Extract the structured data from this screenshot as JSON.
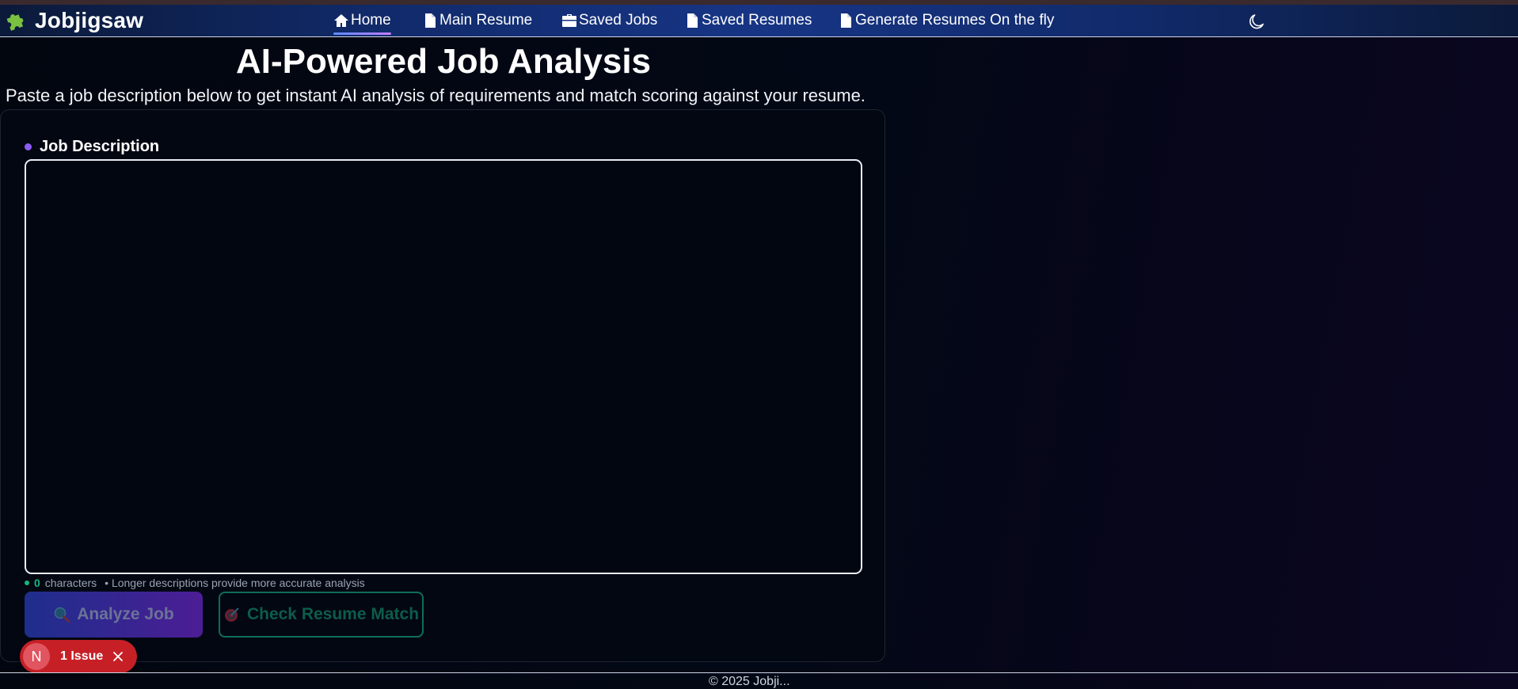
{
  "app": {
    "brand": "Jobjigsaw"
  },
  "nav": {
    "items": [
      {
        "label": "Home",
        "icon": "home-icon",
        "active": true
      },
      {
        "label": "Main Resume",
        "icon": "document-icon"
      },
      {
        "label": "Saved Jobs",
        "icon": "briefcase-icon"
      },
      {
        "label": "Saved Resumes",
        "icon": "document-icon"
      },
      {
        "label": "Generate Resumes On the fly",
        "icon": "document-icon"
      }
    ],
    "theme_toggle_icon": "moon-icon"
  },
  "main": {
    "title": "AI-Powered Job Analysis",
    "subtitle": "Paste a job description below to get instant AI analysis of requirements and match scoring against your resume.",
    "form": {
      "label": "Job Description",
      "textarea_value": "",
      "char_count": "0",
      "char_suffix": "characters",
      "hint": "• Longer descriptions provide more accurate analysis"
    },
    "buttons": {
      "analyze": {
        "label": "Analyze Job",
        "icon": "magnifier-icon",
        "disabled": true
      },
      "match": {
        "label": "Check Resume Match",
        "icon": "target-icon",
        "disabled": true
      }
    }
  },
  "issue_badge": {
    "letter": "N",
    "text": "1 Issue"
  },
  "footer": {
    "text": "© 2025 Jobji..."
  },
  "colors": {
    "background": "#02060f",
    "navbar": "#173585",
    "accent_purple": "#8b5cf6",
    "accent_green": "#10b981",
    "issue_red": "#c62026"
  }
}
